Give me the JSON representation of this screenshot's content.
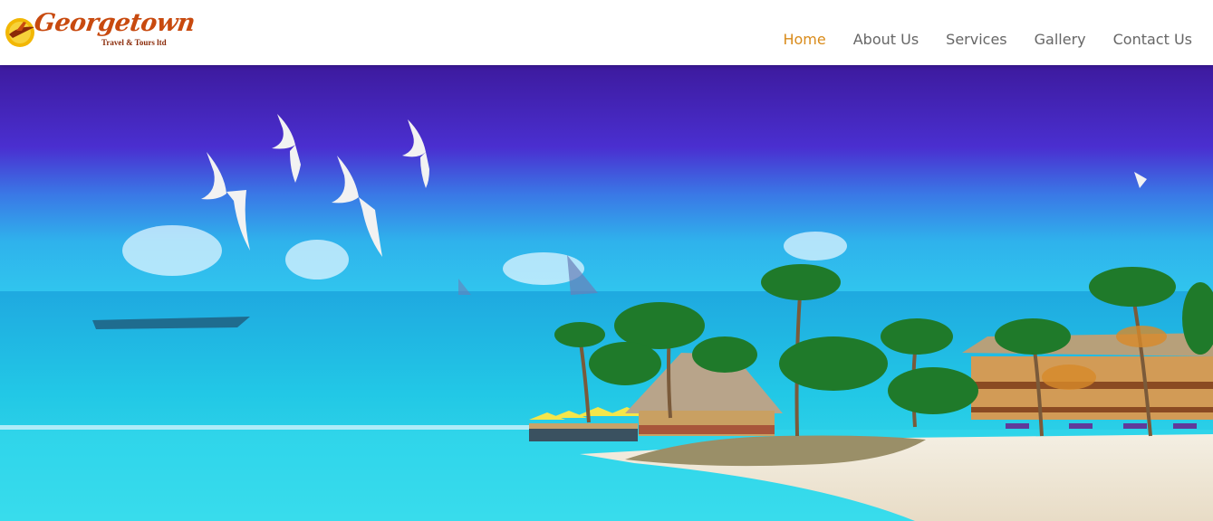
{
  "logo": {
    "name": "Georgetown",
    "tagline": "Travel & Tours ltd"
  },
  "nav": {
    "items": [
      {
        "label": "Home",
        "active": true
      },
      {
        "label": "About Us",
        "active": false
      },
      {
        "label": "Services",
        "active": false
      },
      {
        "label": "Gallery",
        "active": false
      },
      {
        "label": "Contact Us",
        "active": false
      }
    ]
  },
  "colors": {
    "nav_active": "#d98b1a",
    "nav_text": "#666666",
    "logo_text": "#c84a0f",
    "sky_top": "#3d1a9e",
    "sea": "#27c7e0"
  },
  "hero": {
    "image": "tropical-beach-resort-photo"
  }
}
